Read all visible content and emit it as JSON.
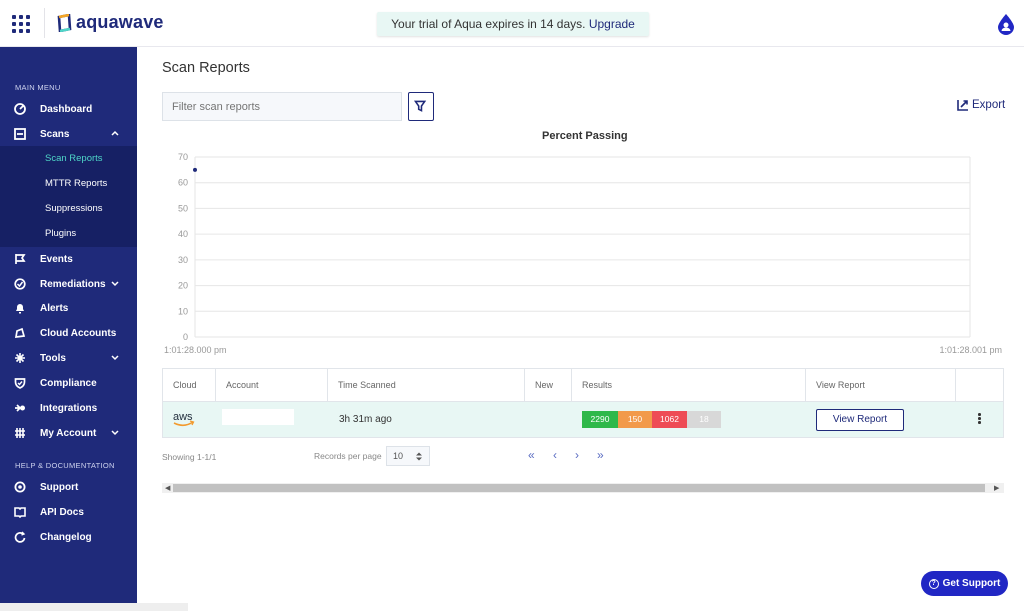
{
  "brand": {
    "name": "aquawave"
  },
  "trial": {
    "text": "Your trial of Aqua expires in 14 days.",
    "link": "Upgrade"
  },
  "sidebar": {
    "main_menu_header": "MAIN MENU",
    "help_header": "HELP & DOCUMENTATION",
    "items": [
      {
        "label": "Dashboard",
        "icon": "gauge-icon"
      },
      {
        "label": "Scans",
        "icon": "scan-icon",
        "expanded": true
      },
      {
        "label": "Events",
        "icon": "flag-icon"
      },
      {
        "label": "Remediations",
        "icon": "remediation-icon"
      },
      {
        "label": "Alerts",
        "icon": "bell-icon"
      },
      {
        "label": "Cloud Accounts",
        "icon": "cloud-icon"
      },
      {
        "label": "Tools",
        "icon": "tools-icon"
      },
      {
        "label": "Compliance",
        "icon": "shield-icon"
      },
      {
        "label": "Integrations",
        "icon": "integrations-icon"
      },
      {
        "label": "My Account",
        "icon": "account-icon"
      }
    ],
    "scan_sub_items": [
      {
        "label": "Scan Reports",
        "active": true
      },
      {
        "label": "MTTR Reports"
      },
      {
        "label": "Suppressions"
      },
      {
        "label": "Plugins"
      }
    ],
    "help_items": [
      {
        "label": "Support",
        "icon": "support-icon"
      },
      {
        "label": "API Docs",
        "icon": "book-icon"
      },
      {
        "label": "Changelog",
        "icon": "changelog-icon"
      }
    ]
  },
  "page": {
    "title": "Scan Reports",
    "filter_placeholder": "Filter scan reports",
    "export_label": "Export"
  },
  "chart_data": {
    "type": "scatter",
    "title": "Percent Passing",
    "x": [
      "1:01:28.000 pm"
    ],
    "values": [
      65
    ],
    "x_tick_labels": [
      "1:01:28.000 pm",
      "1:01:28.001 pm"
    ],
    "y_ticks": [
      0,
      10,
      20,
      30,
      40,
      50,
      60,
      70
    ],
    "ylim": [
      0,
      70
    ],
    "grid": true,
    "colors": {
      "point": "#1f2a7a",
      "grid": "#e6e6e6"
    }
  },
  "table": {
    "columns": [
      "Cloud",
      "Account",
      "Time Scanned",
      "New",
      "Results",
      "View Report"
    ],
    "rows": [
      {
        "cloud": "aws",
        "account": "",
        "time_scanned": "3h 31m ago",
        "new": "",
        "results": [
          {
            "value": "2290",
            "color": "#2fb84a"
          },
          {
            "value": "150",
            "color": "#f29a4a"
          },
          {
            "value": "1062",
            "color": "#ee4b55"
          },
          {
            "value": "18",
            "color": "#d8d8d8"
          }
        ],
        "view_label": "View Report"
      }
    ]
  },
  "pagination": {
    "showing": "Showing 1-1/1",
    "records_label": "Records per page",
    "records_value": "10",
    "first": "«",
    "prev": "‹",
    "next": "›",
    "last": "»"
  },
  "support_button": "Get Support"
}
